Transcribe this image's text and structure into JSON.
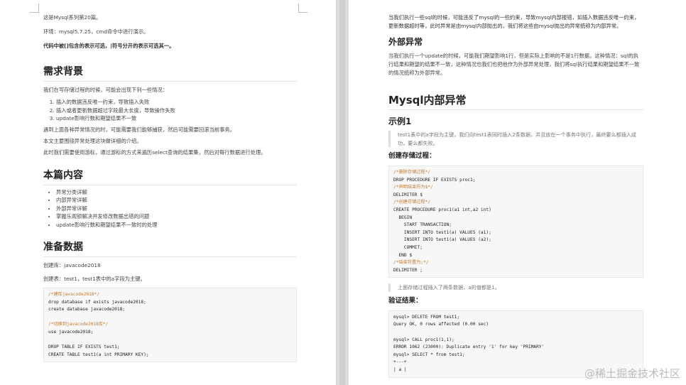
{
  "left": {
    "intro1": "这是Mysql系列第20篇。",
    "intro2": "环境：mysql5.7.25，cmd命令中进行演示。",
    "intro3": "代码中被[]包含的表示可选，|符号分开的表示可选其一。",
    "h_bg": "需求背景",
    "bg_p": "我们在写存储过程的时候，可能会出现下列一些情况：",
    "bg_list": [
      "插入的数据违反唯一约束，导致插入失败",
      "插入或者更新数据超过字段最大长度，导致操作失败",
      "update影响行数和期望结果不一致"
    ],
    "bg_p2": "遇到上面各种异常情况的时，可能需要我们能够捕获，然后可能需要回滚当前事务。",
    "bg_p3": "本文主要围绕异常处理这块做详细的介绍。",
    "bg_p4": "此时我们需要使用游标，通过游标的方式来遍历select查询的结果集，然后对每行数据进行处理。",
    "h_content": "本篇内容",
    "content_list": [
      "异常分类详解",
      "内部异常详解",
      "外部异常详解",
      "掌握乐观锁解决并发修改数据出错的问题",
      "update影响行数和期望结果不一致时的处理"
    ],
    "h_data": "准备数据",
    "db_line": "创建库：javacode2018",
    "table_line": "创建表：test1，test1表中的a字段为主键。",
    "code_lines": [
      {
        "t": "/*建库javacode2018*/",
        "c": "cm"
      },
      {
        "t": "drop database if exists javacode2018;",
        "c": ""
      },
      {
        "t": "create database javacode2018;",
        "c": ""
      },
      {
        "t": "",
        "c": ""
      },
      {
        "t": "/*切换到javacode2018库*/",
        "c": "cm"
      },
      {
        "t": "use javacode2018;",
        "c": ""
      },
      {
        "t": "",
        "c": ""
      },
      {
        "t": "DROP TABLE IF EXISTS test1;",
        "c": ""
      },
      {
        "t": "CREATE TABLE test1(a int PRIMARY KEY);",
        "c": ""
      }
    ]
  },
  "right": {
    "top_p": "当我们执行一些sql的时候，可能违反了mysql的一些约束，导致mysql内部报错，如插入数据违反唯一约束，更新数据超时等，此时异常是由mysql内部抛出的，我们将这些由mysql抛出的异常统称为内部异常。",
    "h_outer": "外部异常",
    "outer_p": "当我们执行一个update的时候，可能我们期望影响1行，但是实际上影响的不是1行数据，这种情况：sql的执行结果和期望的结果不一致，这种情况也我们也把他作为外部异常处理，我们将sql执行结果和期望结果不一致的情况统称为外部异常。",
    "h_inner": "Mysql内部异常",
    "h_ex1": "示例1",
    "ex1_quote": "test1表中的a字段为主键，我们向test1表同时插入2条数据，并且放在一个事务中执行，最终要么都插入成功，要么都失败。",
    "h_proc": "创建存储过程：",
    "proc_code": [
      {
        "t": "/*删除存储过程*/",
        "c": "cm"
      },
      {
        "t": "DROP PROCEDURE IF EXISTS proc1;",
        "c": ""
      },
      {
        "t": "/*声明结束符为$*/",
        "c": "cm"
      },
      {
        "t": "DELIMITER $",
        "c": ""
      },
      {
        "t": "/*创建存储过程*/",
        "c": "cm"
      },
      {
        "t": "CREATE PROCEDURE proc1(a1 int,a2 int)",
        "c": ""
      },
      {
        "t": "  BEGIN",
        "c": ""
      },
      {
        "t": "    START TRANSACTION;",
        "c": ""
      },
      {
        "t": "    INSERT INTO test1(a) VALUES (a1);",
        "c": ""
      },
      {
        "t": "    INSERT INTO test1(a) VALUES (a2);",
        "c": ""
      },
      {
        "t": "    COMMIT;",
        "c": ""
      },
      {
        "t": "  END $",
        "c": ""
      },
      {
        "t": "/*结束符置为;*/",
        "c": "cm"
      },
      {
        "t": "DELIMITER ;",
        "c": ""
      }
    ],
    "proc_quote": "上面存储过程插入了两条数据，a的值都是1。",
    "h_verify": "验证结果：",
    "verify_code": [
      {
        "t": "mysql> DELETE FROM test1;",
        "c": ""
      },
      {
        "t": "Query OK, 0 rows affected (0.00 sec)",
        "c": ""
      },
      {
        "t": "",
        "c": ""
      },
      {
        "t": "mysql> CALL proc1(1,1);",
        "c": ""
      },
      {
        "t": "ERROR 1062 (23000): Duplicate entry '1' for key 'PRIMARY'",
        "c": ""
      },
      {
        "t": "mysql> SELECT * from test1;",
        "c": ""
      },
      {
        "t": "+---+",
        "c": ""
      },
      {
        "t": "| a |",
        "c": ""
      }
    ],
    "watermark": "@稀土掘金技术社区"
  }
}
